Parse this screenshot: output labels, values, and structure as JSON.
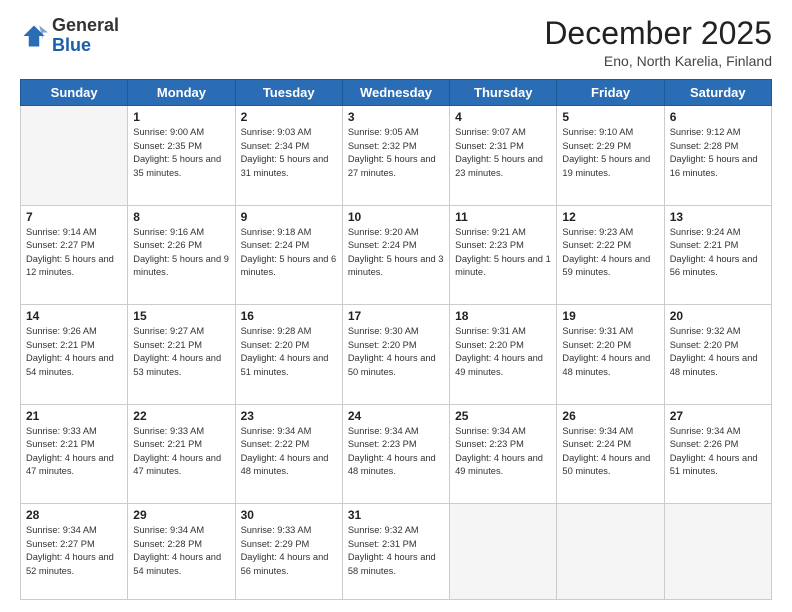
{
  "header": {
    "logo_general": "General",
    "logo_blue": "Blue",
    "title": "December 2025",
    "subtitle": "Eno, North Karelia, Finland"
  },
  "days_of_week": [
    "Sunday",
    "Monday",
    "Tuesday",
    "Wednesday",
    "Thursday",
    "Friday",
    "Saturday"
  ],
  "weeks": [
    [
      {
        "day": "",
        "info": ""
      },
      {
        "day": "1",
        "info": "Sunrise: 9:00 AM\nSunset: 2:35 PM\nDaylight: 5 hours\nand 35 minutes."
      },
      {
        "day": "2",
        "info": "Sunrise: 9:03 AM\nSunset: 2:34 PM\nDaylight: 5 hours\nand 31 minutes."
      },
      {
        "day": "3",
        "info": "Sunrise: 9:05 AM\nSunset: 2:32 PM\nDaylight: 5 hours\nand 27 minutes."
      },
      {
        "day": "4",
        "info": "Sunrise: 9:07 AM\nSunset: 2:31 PM\nDaylight: 5 hours\nand 23 minutes."
      },
      {
        "day": "5",
        "info": "Sunrise: 9:10 AM\nSunset: 2:29 PM\nDaylight: 5 hours\nand 19 minutes."
      },
      {
        "day": "6",
        "info": "Sunrise: 9:12 AM\nSunset: 2:28 PM\nDaylight: 5 hours\nand 16 minutes."
      }
    ],
    [
      {
        "day": "7",
        "info": "Sunrise: 9:14 AM\nSunset: 2:27 PM\nDaylight: 5 hours\nand 12 minutes."
      },
      {
        "day": "8",
        "info": "Sunrise: 9:16 AM\nSunset: 2:26 PM\nDaylight: 5 hours\nand 9 minutes."
      },
      {
        "day": "9",
        "info": "Sunrise: 9:18 AM\nSunset: 2:24 PM\nDaylight: 5 hours\nand 6 minutes."
      },
      {
        "day": "10",
        "info": "Sunrise: 9:20 AM\nSunset: 2:24 PM\nDaylight: 5 hours\nand 3 minutes."
      },
      {
        "day": "11",
        "info": "Sunrise: 9:21 AM\nSunset: 2:23 PM\nDaylight: 5 hours\nand 1 minute."
      },
      {
        "day": "12",
        "info": "Sunrise: 9:23 AM\nSunset: 2:22 PM\nDaylight: 4 hours\nand 59 minutes."
      },
      {
        "day": "13",
        "info": "Sunrise: 9:24 AM\nSunset: 2:21 PM\nDaylight: 4 hours\nand 56 minutes."
      }
    ],
    [
      {
        "day": "14",
        "info": "Sunrise: 9:26 AM\nSunset: 2:21 PM\nDaylight: 4 hours\nand 54 minutes."
      },
      {
        "day": "15",
        "info": "Sunrise: 9:27 AM\nSunset: 2:21 PM\nDaylight: 4 hours\nand 53 minutes."
      },
      {
        "day": "16",
        "info": "Sunrise: 9:28 AM\nSunset: 2:20 PM\nDaylight: 4 hours\nand 51 minutes."
      },
      {
        "day": "17",
        "info": "Sunrise: 9:30 AM\nSunset: 2:20 PM\nDaylight: 4 hours\nand 50 minutes."
      },
      {
        "day": "18",
        "info": "Sunrise: 9:31 AM\nSunset: 2:20 PM\nDaylight: 4 hours\nand 49 minutes."
      },
      {
        "day": "19",
        "info": "Sunrise: 9:31 AM\nSunset: 2:20 PM\nDaylight: 4 hours\nand 48 minutes."
      },
      {
        "day": "20",
        "info": "Sunrise: 9:32 AM\nSunset: 2:20 PM\nDaylight: 4 hours\nand 48 minutes."
      }
    ],
    [
      {
        "day": "21",
        "info": "Sunrise: 9:33 AM\nSunset: 2:21 PM\nDaylight: 4 hours\nand 47 minutes."
      },
      {
        "day": "22",
        "info": "Sunrise: 9:33 AM\nSunset: 2:21 PM\nDaylight: 4 hours\nand 47 minutes."
      },
      {
        "day": "23",
        "info": "Sunrise: 9:34 AM\nSunset: 2:22 PM\nDaylight: 4 hours\nand 48 minutes."
      },
      {
        "day": "24",
        "info": "Sunrise: 9:34 AM\nSunset: 2:23 PM\nDaylight: 4 hours\nand 48 minutes."
      },
      {
        "day": "25",
        "info": "Sunrise: 9:34 AM\nSunset: 2:23 PM\nDaylight: 4 hours\nand 49 minutes."
      },
      {
        "day": "26",
        "info": "Sunrise: 9:34 AM\nSunset: 2:24 PM\nDaylight: 4 hours\nand 50 minutes."
      },
      {
        "day": "27",
        "info": "Sunrise: 9:34 AM\nSunset: 2:26 PM\nDaylight: 4 hours\nand 51 minutes."
      }
    ],
    [
      {
        "day": "28",
        "info": "Sunrise: 9:34 AM\nSunset: 2:27 PM\nDaylight: 4 hours\nand 52 minutes."
      },
      {
        "day": "29",
        "info": "Sunrise: 9:34 AM\nSunset: 2:28 PM\nDaylight: 4 hours\nand 54 minutes."
      },
      {
        "day": "30",
        "info": "Sunrise: 9:33 AM\nSunset: 2:29 PM\nDaylight: 4 hours\nand 56 minutes."
      },
      {
        "day": "31",
        "info": "Sunrise: 9:32 AM\nSunset: 2:31 PM\nDaylight: 4 hours\nand 58 minutes."
      },
      {
        "day": "",
        "info": ""
      },
      {
        "day": "",
        "info": ""
      },
      {
        "day": "",
        "info": ""
      }
    ]
  ]
}
